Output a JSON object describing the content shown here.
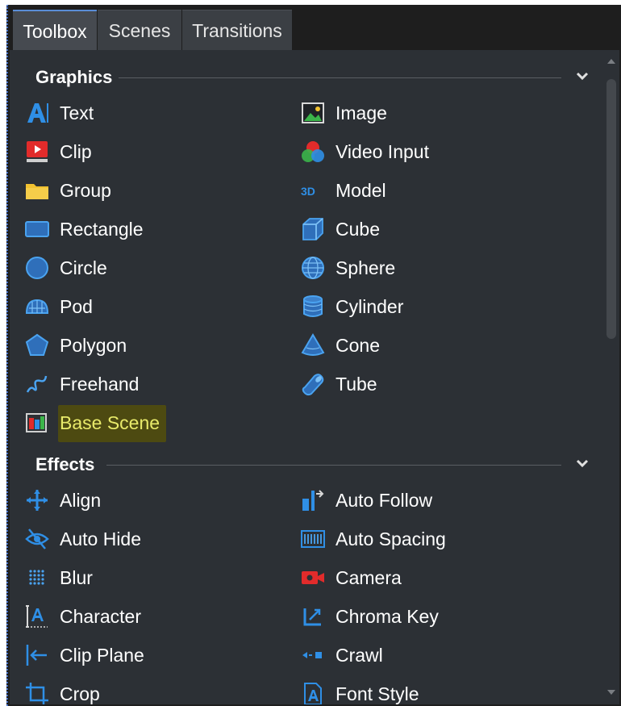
{
  "tabs": [
    {
      "label": "Toolbox"
    },
    {
      "label": "Scenes"
    },
    {
      "label": "Transitions"
    }
  ],
  "graphics": {
    "title": "Graphics",
    "items": [
      {
        "label": "Text",
        "icon": "text-icon"
      },
      {
        "label": "Image",
        "icon": "image-icon"
      },
      {
        "label": "Clip",
        "icon": "clip-icon"
      },
      {
        "label": "Video Input",
        "icon": "video-input-icon"
      },
      {
        "label": "Group",
        "icon": "folder-icon"
      },
      {
        "label": "Model",
        "icon": "3d-model-icon"
      },
      {
        "label": "Rectangle",
        "icon": "rectangle-icon"
      },
      {
        "label": "Cube",
        "icon": "cube-icon"
      },
      {
        "label": "Circle",
        "icon": "circle-icon"
      },
      {
        "label": "Sphere",
        "icon": "sphere-icon"
      },
      {
        "label": "Pod",
        "icon": "pod-icon"
      },
      {
        "label": "Cylinder",
        "icon": "cylinder-icon"
      },
      {
        "label": "Polygon",
        "icon": "polygon-icon"
      },
      {
        "label": "Cone",
        "icon": "cone-icon"
      },
      {
        "label": "Freehand",
        "icon": "freehand-icon"
      },
      {
        "label": "Tube",
        "icon": "tube-icon"
      },
      {
        "label": "Base Scene",
        "icon": "base-scene-icon",
        "highlighted": true
      }
    ]
  },
  "effects": {
    "title": "Effects",
    "items": [
      {
        "label": "Align",
        "icon": "align-icon"
      },
      {
        "label": "Auto Follow",
        "icon": "auto-follow-icon"
      },
      {
        "label": "Auto Hide",
        "icon": "auto-hide-icon"
      },
      {
        "label": "Auto Spacing",
        "icon": "auto-spacing-icon"
      },
      {
        "label": "Blur",
        "icon": "blur-icon"
      },
      {
        "label": "Camera",
        "icon": "camera-icon"
      },
      {
        "label": "Character",
        "icon": "character-icon"
      },
      {
        "label": "Chroma Key",
        "icon": "chroma-key-icon"
      },
      {
        "label": "Clip Plane",
        "icon": "clip-plane-icon"
      },
      {
        "label": "Crawl",
        "icon": "crawl-icon"
      },
      {
        "label": "Crop",
        "icon": "crop-icon"
      },
      {
        "label": "Font Style",
        "icon": "font-style-icon"
      }
    ]
  },
  "colors": {
    "accent_blue": "#2f8fe6",
    "highlight_bg": "#4d4a11",
    "highlight_text": "#e8ea6a",
    "panel_bg": "#2c3035"
  }
}
